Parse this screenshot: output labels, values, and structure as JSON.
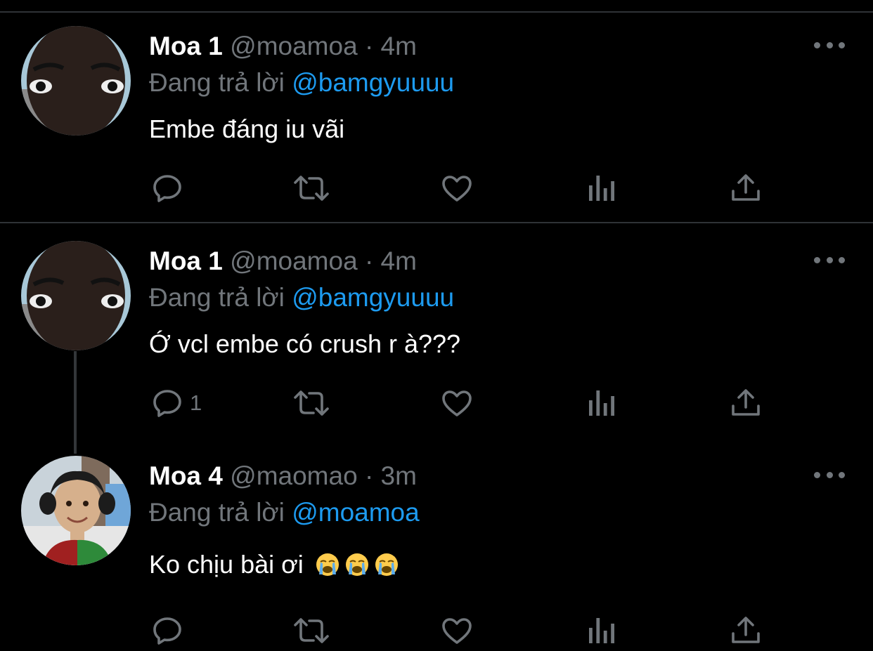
{
  "tweets": [
    {
      "name": "Moa 1",
      "handle": "@moamoa",
      "time": "· 4m",
      "reply_prefix": "Đang trả lời",
      "reply_to": "@bamgyuuuu",
      "text": "Embe đáng iu vãi",
      "reply_count": "",
      "emojis": []
    },
    {
      "name": "Moa 1",
      "handle": "@moamoa",
      "time": "· 4m",
      "reply_prefix": "Đang trả lời",
      "reply_to": "@bamgyuuuu",
      "text": "Ớ vcl embe có crush r à???",
      "reply_count": "1",
      "emojis": []
    },
    {
      "name": "Moa 4",
      "handle": "@maomao",
      "time": "· 3m",
      "reply_prefix": "Đang trả lời",
      "reply_to": "@moamoa",
      "text": "Ko chịu bài ơi",
      "reply_count": "",
      "emojis": [
        "loudly-crying-face",
        "loudly-crying-face",
        "loudly-crying-face"
      ]
    }
  ],
  "colors": {
    "background": "#000000",
    "text": "#ffffff",
    "secondary": "#71767b",
    "mention": "#1d9bf0",
    "divider": "#2f3336"
  },
  "icons": [
    "reply-icon",
    "retweet-icon",
    "like-icon",
    "analytics-icon",
    "share-icon",
    "more-icon"
  ]
}
